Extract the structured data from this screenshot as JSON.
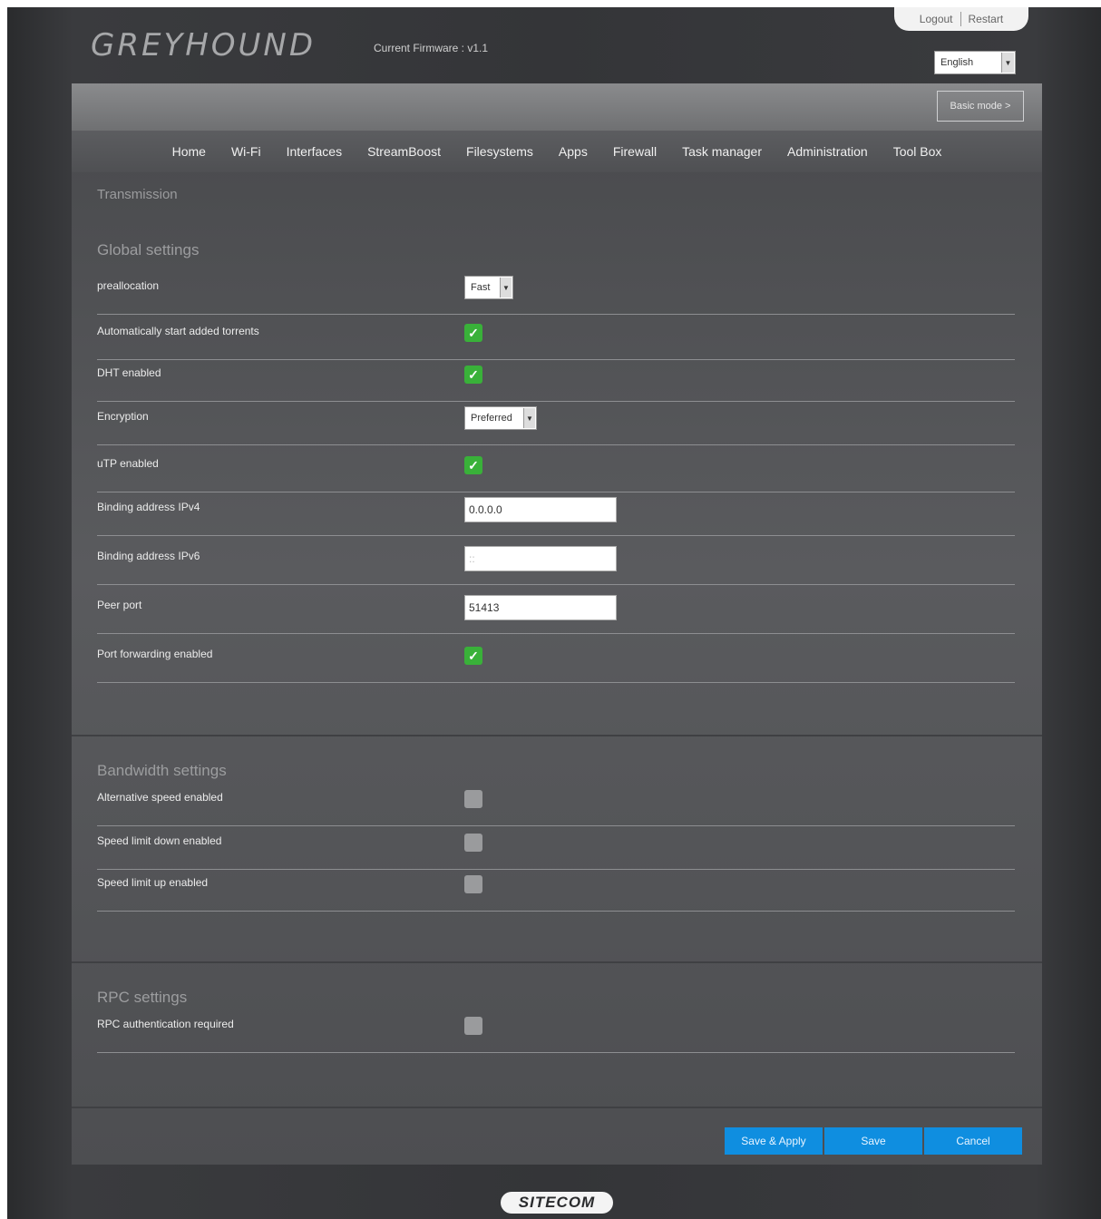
{
  "header": {
    "logo": "GREYHOUND",
    "firmware": "Current Firmware : v1.1",
    "logout": "Logout",
    "restart": "Restart",
    "language": "English",
    "mode_button": "Basic mode >"
  },
  "nav": [
    "Home",
    "Wi-Fi",
    "Interfaces",
    "StreamBoost",
    "Filesystems",
    "Apps",
    "Firewall",
    "Task manager",
    "Administration",
    "Tool Box"
  ],
  "breadcrumb": "Transmission",
  "sections": {
    "global": {
      "title": "Global settings",
      "preallocation": {
        "label": "preallocation",
        "value": "Fast"
      },
      "autostart": {
        "label": "Automatically start added torrents",
        "checked": true
      },
      "dht": {
        "label": "DHT enabled",
        "checked": true
      },
      "encryption": {
        "label": "Encryption",
        "value": "Preferred"
      },
      "utp": {
        "label": "uTP enabled",
        "checked": true
      },
      "ipv4": {
        "label": "Binding address IPv4",
        "value": "0.0.0.0"
      },
      "ipv6": {
        "label": "Binding address IPv6",
        "value": "::"
      },
      "peer_port": {
        "label": "Peer port",
        "value": "51413"
      },
      "port_forwarding": {
        "label": "Port forwarding enabled",
        "checked": true
      }
    },
    "bandwidth": {
      "title": "Bandwidth settings",
      "alt_speed": {
        "label": "Alternative speed enabled",
        "checked": false
      },
      "down_limit": {
        "label": "Speed limit down enabled",
        "checked": false
      },
      "up_limit": {
        "label": "Speed limit up enabled",
        "checked": false
      }
    },
    "rpc": {
      "title": "RPC settings",
      "auth": {
        "label": "RPC authentication required",
        "checked": false
      }
    }
  },
  "footer": {
    "save_apply": "Save & Apply",
    "save": "Save",
    "cancel": "Cancel"
  },
  "brand": "SITECOM",
  "check_glyph": "✓",
  "dropdown_glyph": "▼",
  "colors": {
    "checked": "#39b139",
    "unchecked": "#9a9b9d",
    "button": "#0f8ee0"
  }
}
